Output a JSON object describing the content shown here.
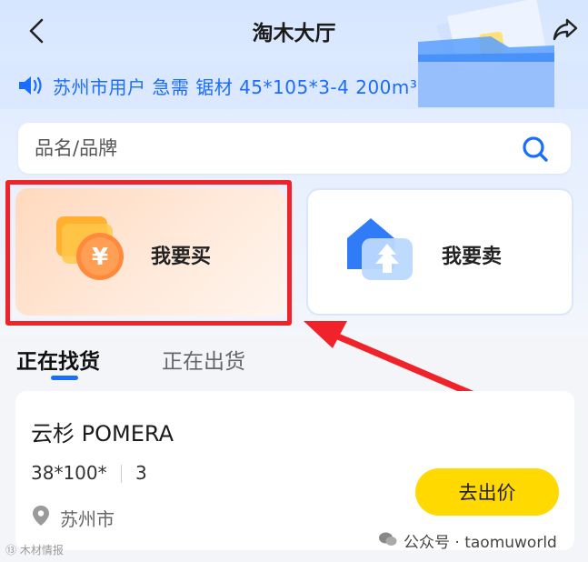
{
  "header": {
    "title": "淘木大厅",
    "back_icon": "chevron-left-icon",
    "share_icon": "share-arrow-icon"
  },
  "notice": {
    "icon": "speaker-icon",
    "text": "苏州市用户 急需 锯材 45*105*3-4 200m³"
  },
  "search": {
    "placeholder": "品名/品牌",
    "icon": "search-icon"
  },
  "actions": {
    "buy_label": "我要买",
    "sell_label": "我要卖",
    "buy_icon": "yuan-coin-icon",
    "sell_icon": "tree-house-icon"
  },
  "tabs": [
    {
      "label": "正在找货",
      "active": true
    },
    {
      "label": "正在出货",
      "active": false
    }
  ],
  "listing": {
    "title": "云杉 POMERA",
    "spec": "38*100*",
    "quantity": "3",
    "city": "苏州市",
    "offer_button": "去出价"
  },
  "watermark": {
    "account": "公众号 · taomuworld",
    "bottom": "⑬ 木材情报"
  },
  "colors": {
    "accent": "#1a6dff",
    "highlight_red": "#f0222a",
    "button_yellow": "#ffd900"
  }
}
